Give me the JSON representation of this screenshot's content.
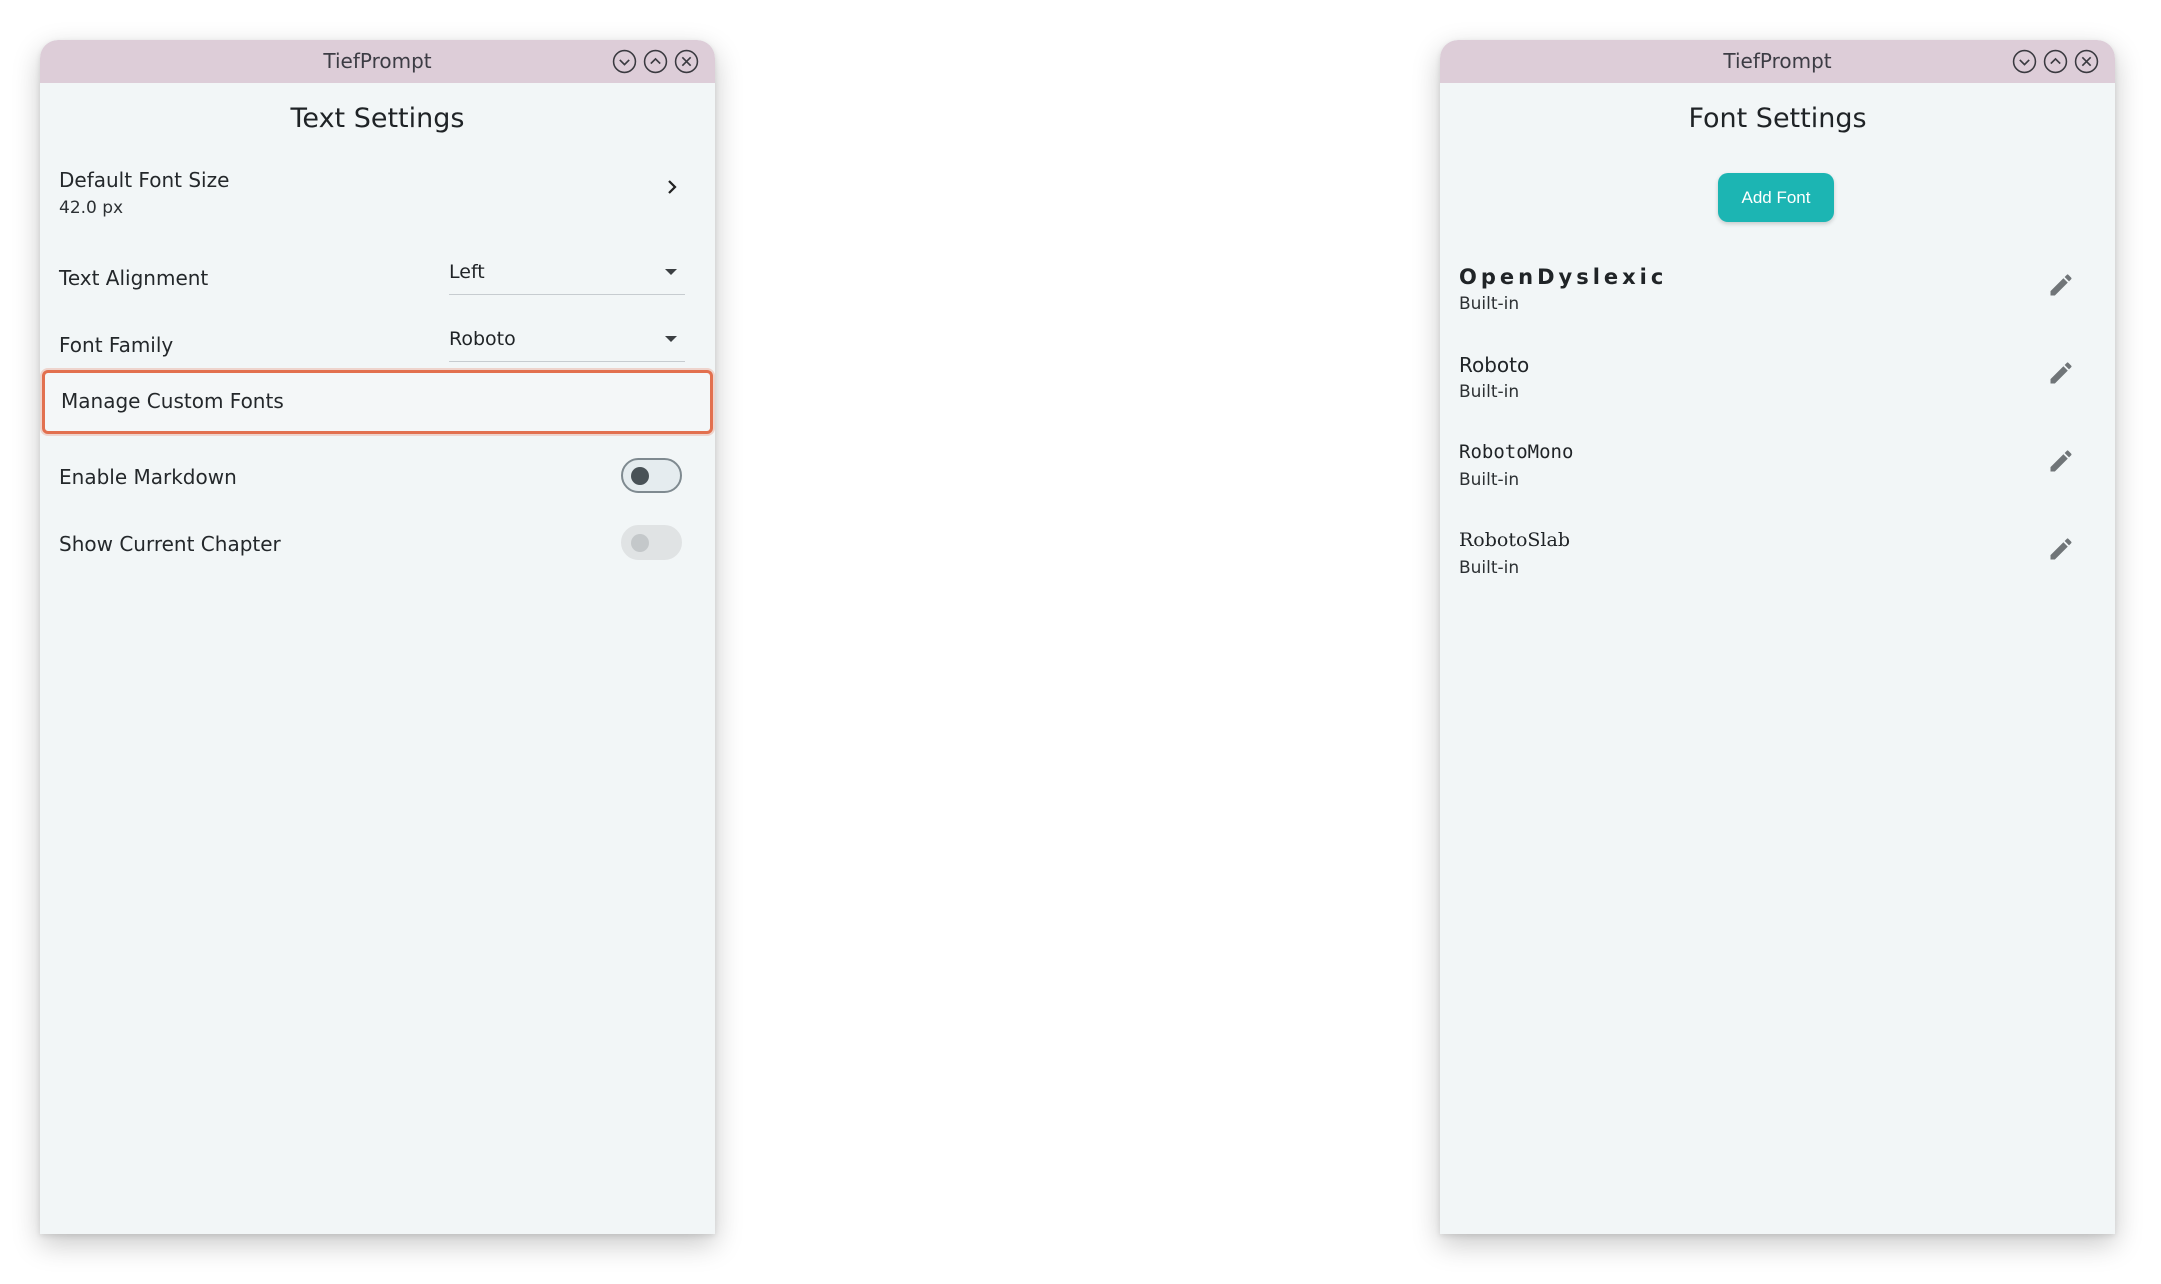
{
  "left_window": {
    "app_title": "TiefPrompt",
    "page_title": "Text Settings",
    "default_font_size": {
      "label": "Default Font Size",
      "value": "42.0 px"
    },
    "text_alignment": {
      "label": "Text Alignment",
      "value": "Left"
    },
    "font_family": {
      "label": "Font Family",
      "value": "Roboto"
    },
    "manage_custom_fonts": {
      "label": "Manage Custom Fonts"
    },
    "enable_markdown": {
      "label": "Enable Markdown",
      "state": "off"
    },
    "show_current_chapter": {
      "label": "Show Current Chapter",
      "state": "off-disabled"
    }
  },
  "right_window": {
    "app_title": "TiefPrompt",
    "page_title": "Font Settings",
    "add_font_label": "Add Font",
    "fonts": [
      {
        "name": "OpenDyslexic",
        "source": "Built-in"
      },
      {
        "name": "Roboto",
        "source": "Built-in"
      },
      {
        "name": "RobotoMono",
        "source": "Built-in"
      },
      {
        "name": "RobotoSlab",
        "source": "Built-in"
      }
    ]
  },
  "colors": {
    "titlebar": "#ddcdd8",
    "background": "#f2f6f7",
    "accent": "#1cb5b3",
    "highlight": "#e2704f"
  },
  "icons": {
    "window_controls": [
      "minimize-icon",
      "maximize-icon",
      "close-icon"
    ],
    "row_chevron": "chevron-right-icon",
    "edit": "pencil-icon"
  }
}
